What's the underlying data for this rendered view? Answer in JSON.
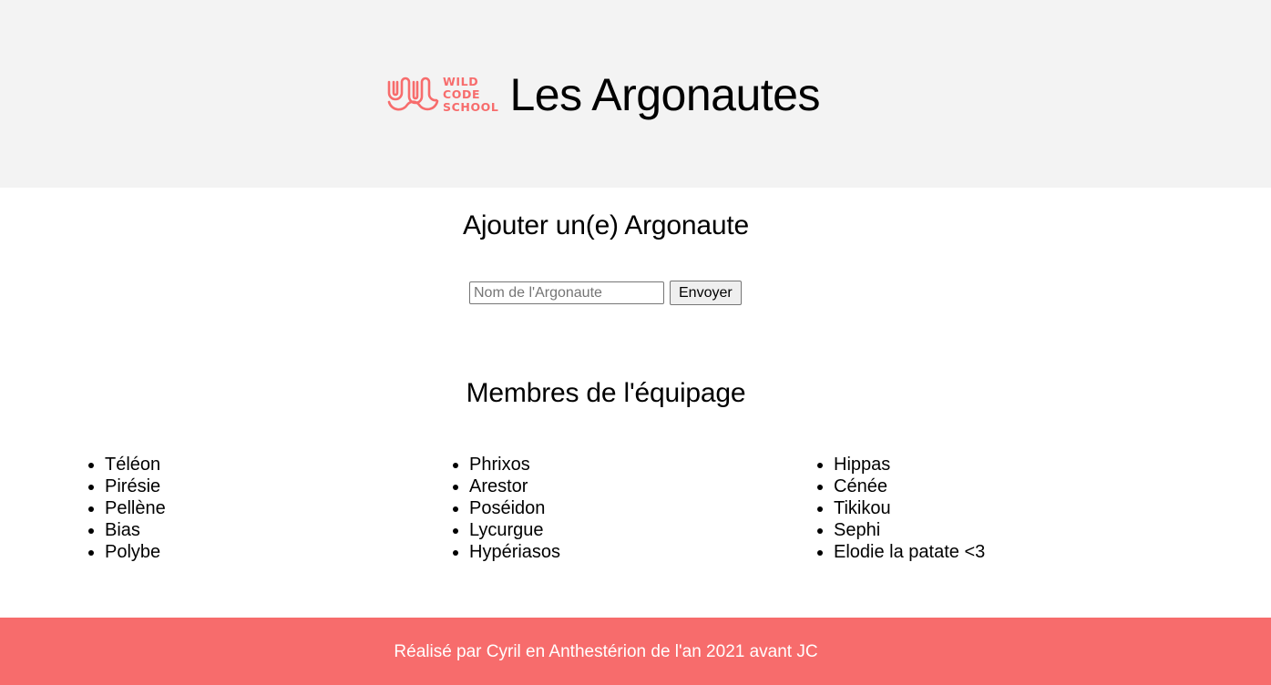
{
  "header": {
    "logo": {
      "lines": [
        "WILD",
        "CODE",
        "SCHOOL"
      ],
      "icon": "wild-code-school-logo-icon"
    },
    "title": "Les Argonautes",
    "background": "#f3f3f3"
  },
  "add_section": {
    "title": "Ajouter un(e) Argonaute",
    "input": {
      "placeholder": "Nom de l'Argonaute",
      "value": ""
    },
    "submit_label": "Envoyer"
  },
  "crew_section": {
    "title": "Membres de l'équipage",
    "columns": [
      [
        "Téléon",
        "Pirésie",
        "Pellène",
        "Bias",
        "Polybe"
      ],
      [
        "Phrixos",
        "Arestor",
        "Poséidon",
        "Lycurgue",
        "Hypériasos"
      ],
      [
        "Hippas",
        "Cénée",
        "Tikikou",
        "Sephi",
        "Elodie la patate <3"
      ]
    ]
  },
  "footer": {
    "text": "Réalisé par Cyril en Anthestérion de l'an 2021 avant JC",
    "background": "#f76c6c"
  },
  "colors": {
    "accent": "#f76c6c",
    "text": "#000000"
  }
}
